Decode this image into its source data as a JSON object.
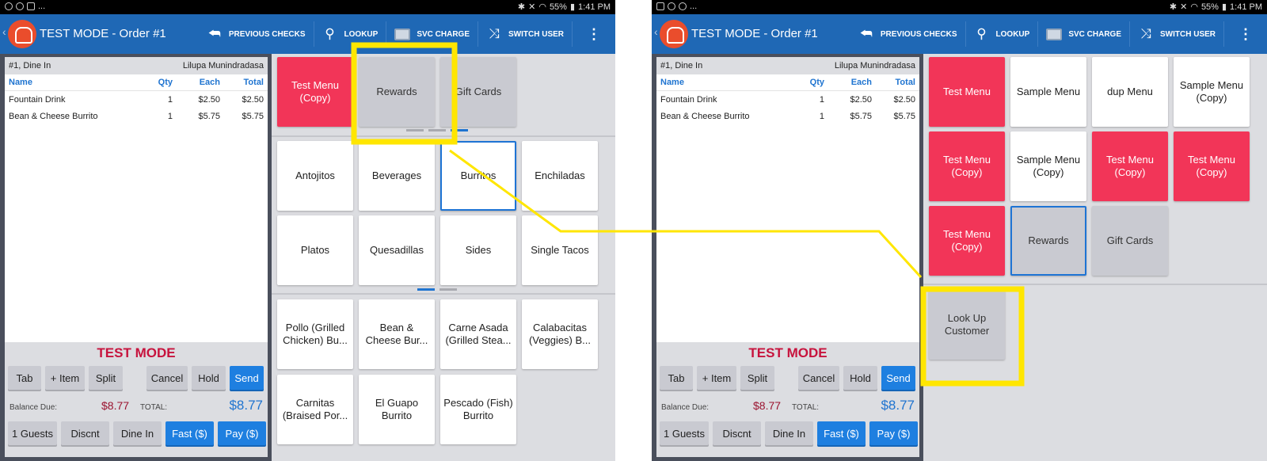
{
  "colors": {
    "appbar": "#1f68b5",
    "red_tile": "#f23558",
    "highlight": "#ffe600",
    "accent_blue": "#1e7fe0",
    "test_mode_red": "#c7133d"
  },
  "devices": [
    {
      "status_bar": {
        "left_icons": [
          "alarm-icon",
          "sync-icon",
          "mail-icon"
        ],
        "more": "...",
        "battery": "55%",
        "time": "1:41 PM"
      },
      "app_title": "TEST MODE - Order #1",
      "actions": [
        {
          "icon": "previous-checks-icon",
          "label": "PREVIOUS CHECKS"
        },
        {
          "icon": "search-icon",
          "label": "LOOKUP"
        },
        {
          "icon": "svc-charge-icon",
          "label": "SVC CHARGE"
        },
        {
          "icon": "shuffle-icon",
          "label": "SWITCH USER"
        }
      ],
      "order": {
        "header_left": "#1, Dine In",
        "header_right": "Lilupa Munindradasa",
        "columns": [
          "Name",
          "Qty",
          "Each",
          "Total"
        ],
        "items": [
          {
            "name": "Fountain Drink",
            "qty": "1",
            "each": "$2.50",
            "total": "$2.50"
          },
          {
            "name": "Bean & Cheese Burrito",
            "qty": "1",
            "each": "$5.75",
            "total": "$5.75"
          }
        ],
        "mode_label": "TEST MODE",
        "buttons_row1": [
          "Tab",
          "+ Item",
          "Split",
          "Cancel",
          "Hold",
          "Send"
        ],
        "balance_label": "Balance Due:",
        "balance_value": "$8.77",
        "total_label": "TOTAL:",
        "total_value": "$8.77",
        "buttons_row2": [
          "1 Guests",
          "Discnt",
          "Dine In",
          "Fast ($)",
          "Pay ($)"
        ]
      },
      "menu_groups": [
        "Test Menu (Copy)",
        "Rewards",
        "Gift Cards"
      ],
      "categories": [
        "Antojitos",
        "Beverages",
        "Burritos",
        "Enchiladas",
        "Platos",
        "Quesadillas",
        "Sides",
        "Single Tacos"
      ],
      "selected_category": "Burritos",
      "items": [
        "Pollo (Grilled Chicken) Bu...",
        "Bean & Cheese Bur...",
        "Carne Asada (Grilled Stea...",
        "Calabacitas (Veggies) B...",
        "Carnitas (Braised Por...",
        "El Guapo Burrito",
        "Pescado (Fish) Burrito"
      ]
    },
    {
      "status_bar": {
        "left_icons": [
          "image-icon",
          "alarm-icon",
          "sync-icon"
        ],
        "more": "...",
        "battery": "55%",
        "time": "1:41 PM"
      },
      "app_title": "TEST MODE - Order #1",
      "actions": [
        {
          "icon": "previous-checks-icon",
          "label": "PREVIOUS CHECKS"
        },
        {
          "icon": "search-icon",
          "label": "LOOKUP"
        },
        {
          "icon": "svc-charge-icon",
          "label": "SVC CHARGE"
        },
        {
          "icon": "shuffle-icon",
          "label": "SWITCH USER"
        }
      ],
      "order": {
        "header_left": "#1, Dine In",
        "header_right": "Lilupa Munindradasa",
        "columns": [
          "Name",
          "Qty",
          "Each",
          "Total"
        ],
        "items": [
          {
            "name": "Fountain Drink",
            "qty": "1",
            "each": "$2.50",
            "total": "$2.50"
          },
          {
            "name": "Bean & Cheese Burrito",
            "qty": "1",
            "each": "$5.75",
            "total": "$5.75"
          }
        ],
        "mode_label": "TEST MODE",
        "buttons_row1": [
          "Tab",
          "+ Item",
          "Split",
          "Cancel",
          "Hold",
          "Send"
        ],
        "balance_label": "Balance Due:",
        "balance_value": "$8.77",
        "total_label": "TOTAL:",
        "total_value": "$8.77",
        "buttons_row2": [
          "1 Guests",
          "Discnt",
          "Dine In",
          "Fast ($)",
          "Pay ($)"
        ]
      },
      "menu_groups": [
        "Test Menu",
        "Sample Menu",
        "dup Menu",
        "Sample Menu (Copy)",
        "Test Menu (Copy)",
        "Sample Menu (Copy)",
        "Test Menu (Copy)",
        "Test Menu (Copy)",
        "Test Menu (Copy)",
        "Rewards",
        "Gift Cards"
      ],
      "selected_group": "Rewards",
      "categories": [
        "Look Up Customer"
      ]
    }
  ]
}
